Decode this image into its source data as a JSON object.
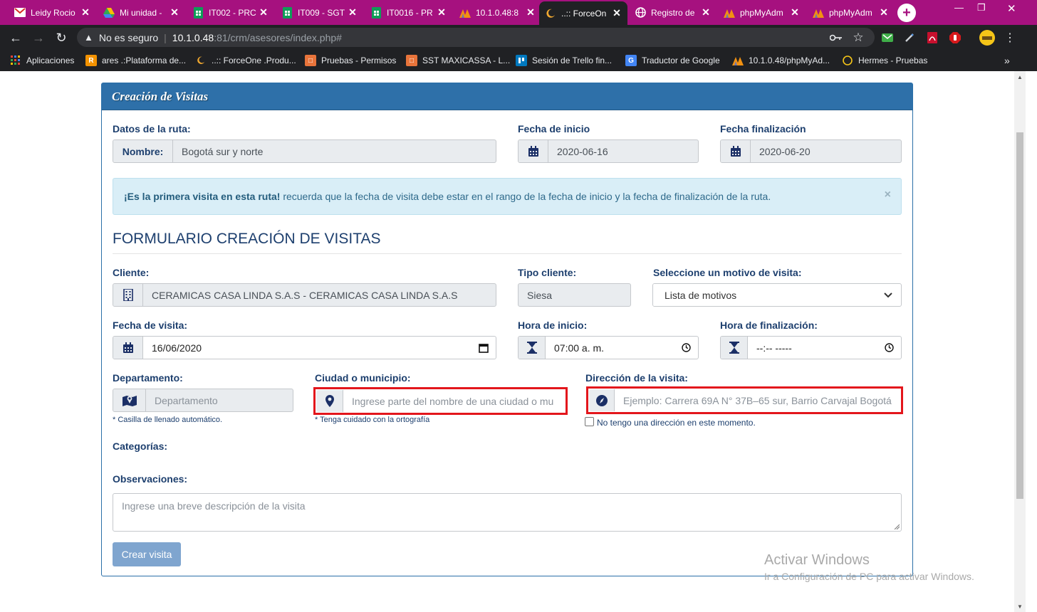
{
  "browser": {
    "tabs": [
      {
        "title": "Leidy Rocio",
        "icon": "gmail-icon"
      },
      {
        "title": "Mi unidad -",
        "icon": "google-drive-icon"
      },
      {
        "title": "IT002 - PRC",
        "icon": "google-sheets-icon"
      },
      {
        "title": "IT009 - SGT",
        "icon": "google-sheets-icon"
      },
      {
        "title": "IT0016 - PR",
        "icon": "google-sheets-icon"
      },
      {
        "title": "10.1.0.48:8",
        "icon": "phpmyadmin-icon"
      },
      {
        "title": "..:: ForceOn",
        "icon": "forceone-icon"
      },
      {
        "title": "Registro de",
        "icon": "globe-icon"
      },
      {
        "title": "phpMyAdm",
        "icon": "phpmyadmin-icon"
      },
      {
        "title": "phpMyAdm",
        "icon": "phpmyadmin-icon"
      }
    ],
    "address": {
      "security": "No es seguro",
      "host": "10.1.0.48",
      "path": ":81/crm/asesores/index.php#"
    },
    "bookmarks": [
      {
        "label": "Aplicaciones",
        "icon": "apps-grid-icon"
      },
      {
        "label": "ares .:Plataforma de...",
        "icon": "ares-icon"
      },
      {
        "label": "..:: ForceOne .Produ...",
        "icon": "forceone-icon"
      },
      {
        "label": "Pruebas - Permisos",
        "icon": "bitbucket-icon"
      },
      {
        "label": "SST MAXICASSA - L...",
        "icon": "bitbucket-icon"
      },
      {
        "label": "Sesión de Trello fin...",
        "icon": "trello-icon"
      },
      {
        "label": "Traductor de Google",
        "icon": "google-translate-icon"
      },
      {
        "label": "10.1.0.48/phpMyAd...",
        "icon": "phpmyadmin-icon"
      },
      {
        "label": "Hermes - Pruebas",
        "icon": "hermes-icon"
      }
    ]
  },
  "panel": {
    "title": "Creación de Visitas"
  },
  "route": {
    "section_label": "Datos de la ruta:",
    "name_addon": "Nombre:",
    "name_value": "Bogotá sur y norte",
    "start_label": "Fecha de inicio",
    "start_value": "2020-06-16",
    "end_label": "Fecha finalización",
    "end_value": "2020-06-20"
  },
  "alert": {
    "strong": "¡Es la primera visita en esta ruta!",
    "text": " recuerda que la fecha de visita debe estar en el rango de la fecha de inicio y la fecha de finalización de la ruta.",
    "close": "×"
  },
  "form": {
    "title": "FORMULARIO CREACIÓN DE VISITAS",
    "client_label": "Cliente:",
    "client_value": "CERAMICAS CASA LINDA S.A.S - CERAMICAS CASA LINDA S.A.S",
    "client_type_label": "Tipo cliente:",
    "client_type_value": "Siesa",
    "motive_label": "Seleccione un motivo de visita:",
    "motive_value": "Lista de motivos",
    "visit_date_label": "Fecha de visita:",
    "visit_date_value": "16/06/2020",
    "start_time_label": "Hora de inicio:",
    "start_time_value": "07:00 a. m.",
    "end_time_label": "Hora de finalización:",
    "end_time_value": "--:-- -----",
    "department_label": "Departamento:",
    "department_placeholder": "Departamento",
    "department_hint": "* Casilla de llenado automático.",
    "city_label": "Ciudad o municipio:",
    "city_placeholder": "Ingrese parte del nombre de una ciudad o mu",
    "city_hint": "* Tenga cuidado con la ortografía",
    "address_label": "Dirección de la visita:",
    "address_placeholder": "Ejemplo: Carrera 69A N° 37B–65 sur, Barrio Carvajal Bogotá",
    "no_address_label": "No tengo una dirección en este momento.",
    "categories_label": "Categorías:",
    "notes_label": "Observaciones:",
    "notes_placeholder": "Ingrese una breve descripción de la visita",
    "submit_label": "Crear visita"
  },
  "watermark": {
    "line1": "Activar Windows",
    "line2": "Ir a Configuración de PC para activar Windows."
  },
  "colors": {
    "tabbar": "#a6117f",
    "panel_header": "#2e70a9",
    "label_text": "#1d3f6e",
    "highlight_box": "#e3161c",
    "submit_button": "#7fa5cf"
  }
}
